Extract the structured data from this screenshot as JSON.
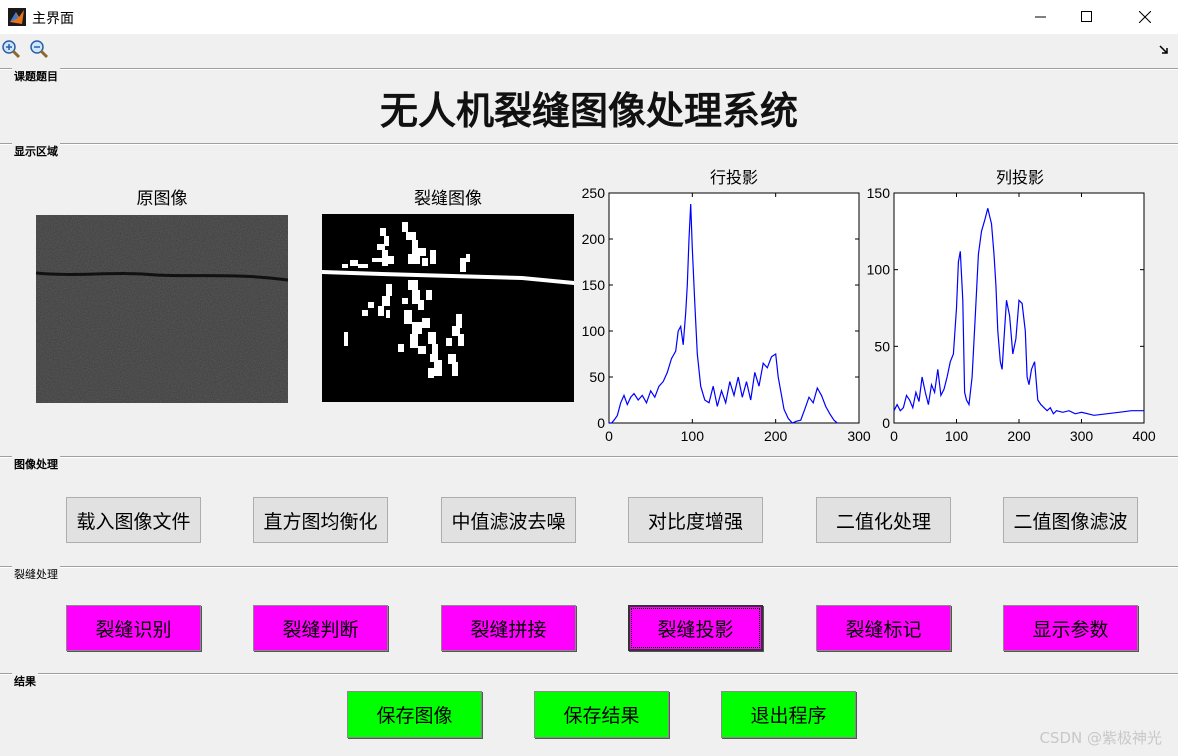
{
  "window": {
    "title": "主界面"
  },
  "panels": {
    "topic": "课题题目",
    "display": "显示区域",
    "image_processing": "图像处理",
    "crack_processing": "裂缝处理",
    "result": "结果"
  },
  "main_title": "无人机裂缝图像处理系统",
  "images": {
    "original_title": "原图像",
    "crack_title": "裂缝图像"
  },
  "plots": {
    "row_title": "行投影",
    "col_title": "列投影"
  },
  "chart_data": [
    {
      "type": "line",
      "title": "行投影",
      "xlim": [
        0,
        300
      ],
      "ylim": [
        0,
        250
      ],
      "xticks": [
        "0",
        "100",
        "200",
        "300"
      ],
      "yticks": [
        "0",
        "50",
        "100",
        "150",
        "200",
        "250"
      ],
      "x": [
        0,
        3,
        6,
        10,
        14,
        18,
        22,
        26,
        30,
        35,
        40,
        45,
        50,
        55,
        60,
        65,
        70,
        75,
        80,
        83,
        86,
        89,
        92,
        94,
        96,
        98,
        100,
        103,
        106,
        110,
        115,
        120,
        125,
        130,
        135,
        140,
        145,
        150,
        155,
        160,
        165,
        170,
        175,
        180,
        185,
        190,
        195,
        200,
        203,
        206,
        210,
        215,
        220,
        225,
        230,
        235,
        240,
        245,
        250,
        255,
        260,
        265,
        270,
        274
      ],
      "y": [
        0,
        0,
        3,
        8,
        22,
        30,
        20,
        28,
        32,
        25,
        30,
        22,
        35,
        28,
        40,
        45,
        55,
        70,
        78,
        100,
        105,
        85,
        120,
        150,
        200,
        238,
        190,
        130,
        75,
        40,
        25,
        22,
        40,
        18,
        35,
        22,
        45,
        30,
        50,
        28,
        45,
        25,
        55,
        40,
        65,
        60,
        72,
        75,
        50,
        35,
        15,
        5,
        0,
        2,
        3,
        15,
        28,
        22,
        38,
        30,
        18,
        10,
        3,
        0
      ]
    },
    {
      "type": "line",
      "title": "列投影",
      "xlim": [
        0,
        400
      ],
      "ylim": [
        0,
        150
      ],
      "xticks": [
        "0",
        "100",
        "200",
        "300",
        "400"
      ],
      "yticks": [
        "0",
        "50",
        "100",
        "150"
      ],
      "x": [
        0,
        5,
        10,
        15,
        20,
        25,
        30,
        35,
        40,
        45,
        50,
        55,
        60,
        65,
        70,
        75,
        80,
        85,
        90,
        95,
        100,
        103,
        106,
        110,
        113,
        116,
        120,
        125,
        130,
        135,
        140,
        145,
        150,
        153,
        156,
        160,
        163,
        166,
        170,
        173,
        176,
        180,
        185,
        190,
        195,
        200,
        205,
        210,
        213,
        216,
        220,
        225,
        230,
        235,
        240,
        245,
        250,
        255,
        260,
        270,
        280,
        290,
        300,
        320,
        340,
        360,
        380,
        400
      ],
      "y": [
        8,
        12,
        8,
        10,
        18,
        15,
        10,
        20,
        14,
        30,
        20,
        12,
        25,
        20,
        35,
        18,
        22,
        30,
        40,
        45,
        75,
        105,
        112,
        80,
        20,
        15,
        12,
        30,
        70,
        110,
        125,
        132,
        140,
        135,
        130,
        110,
        90,
        60,
        40,
        35,
        55,
        80,
        70,
        45,
        55,
        80,
        78,
        60,
        30,
        25,
        35,
        40,
        15,
        12,
        10,
        8,
        10,
        6,
        8,
        7,
        8,
        6,
        7,
        5,
        6,
        7,
        8,
        8
      ]
    }
  ],
  "buttons": {
    "image_processing": [
      "载入图像文件",
      "直方图均衡化",
      "中值滤波去噪",
      "对比度增强",
      "二值化处理",
      "二值图像滤波"
    ],
    "crack_processing": [
      "裂缝识别",
      "裂缝判断",
      "裂缝拼接",
      "裂缝投影",
      "裂缝标记",
      "显示参数"
    ],
    "result": [
      "保存图像",
      "保存结果",
      "退出程序"
    ]
  },
  "colors": {
    "magenta": "#ff00ff",
    "green": "#00ff00",
    "plot_line": "#0000ff"
  },
  "icons": {
    "zoom_in": "zoom-in-icon",
    "zoom_out": "zoom-out-icon",
    "minimize": "minimize-icon",
    "maximize": "maximize-icon",
    "close": "close-icon"
  },
  "watermark": "CSDN @紫极神光"
}
